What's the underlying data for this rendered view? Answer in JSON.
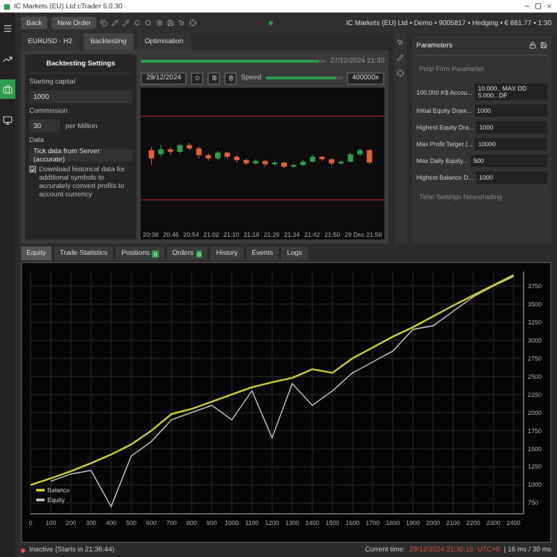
{
  "window": {
    "title": "IC Markets (EU) Ltd cTrader 5.0.30"
  },
  "rail": [
    {
      "selected": false
    },
    {
      "selected": false
    },
    {
      "selected": true
    },
    {
      "selected": false
    }
  ],
  "toolbar": {
    "buttons": [
      "Back",
      "New Order"
    ],
    "account": "IC Markets (EU) Ltd • Demo • 9005817 • Hedging • € 861.77 • 1:30"
  },
  "tabs": [
    {
      "label": "EURUSD · H2",
      "selected": false
    },
    {
      "label": "Backtesting",
      "selected": true
    },
    {
      "label": "Optimisation",
      "selected": false
    }
  ],
  "settings": {
    "title": "Backtesting Settings",
    "capital_label": "Starting capital",
    "capital": "1000",
    "commission_label": "Commission",
    "commission": "30",
    "commission_unit": "per Million",
    "data_label": "Data",
    "data": "Tick data from Server (accurate)",
    "download": {
      "checked": true,
      "label": "Download historical data for additional symbols to accurately convert profits to account currency"
    }
  },
  "player": {
    "progress": {
      "level": 0.96,
      "date": "27/12/2024 21:30"
    },
    "end_date": "29/12/2024",
    "speed_label": "Speed",
    "speed": {
      "level": 0.92
    },
    "speed_value": "400000x",
    "times": [
      "20:38",
      "20:46",
      "20:54",
      "21:02",
      "21:10",
      "21:18",
      "21:26",
      "21:34",
      "21:42",
      "21:50",
      "29 Dec 21:58"
    ]
  },
  "parameters": {
    "title": "Parameters",
    "section": "Prop Firm Parameter",
    "rows": [
      {
        "label": "100.000 K$ Accou...",
        "value": "10.000.. MAX DD 5.000.. DF"
      },
      {
        "label": "Initial Equity Draw...",
        "value": "1000"
      },
      {
        "label": "Highest Equity Dra...",
        "value": "1000"
      },
      {
        "label": "Max Profit Target (...",
        "value": "10000"
      },
      {
        "label": "Max Daily Equity...",
        "value": "500"
      },
      {
        "label": "Highest Balance D...",
        "value": "1000"
      }
    ],
    "section2": "Time Settings Newstrading"
  },
  "bottom_tabs": [
    {
      "label": "Equity",
      "selected": true
    },
    {
      "label": "Trade Statistics",
      "selected": false
    },
    {
      "label": "Positions",
      "selected": false,
      "badge": "0"
    },
    {
      "label": "Orders",
      "selected": false,
      "badge": "0"
    },
    {
      "label": "History",
      "selected": false
    },
    {
      "label": "Events",
      "selected": false
    },
    {
      "label": "Logs",
      "selected": false
    }
  ],
  "equity": {
    "chart_data": {
      "type": "line",
      "x": [
        0,
        100,
        200,
        300,
        400,
        500,
        600,
        700,
        800,
        900,
        1000,
        1100,
        1200,
        1300,
        1400,
        1500,
        1600,
        1700,
        1800,
        1900,
        2000,
        2100,
        2200,
        2300,
        2400
      ],
      "series": [
        {
          "name": "Balance",
          "color": "#c8c832",
          "values": [
            1000,
            1090,
            1190,
            1300,
            1420,
            1560,
            1750,
            1980,
            2050,
            2150,
            2250,
            2350,
            2420,
            2480,
            2600,
            2550,
            2750,
            2900,
            3050,
            3180,
            3330,
            3480,
            3620,
            3760,
            3900
          ]
        },
        {
          "name": "Equity",
          "color": "#bbbbbb",
          "values": [
            null,
            1050,
            1150,
            1200,
            700,
            1400,
            1600,
            1900,
            2000,
            2100,
            1900,
            2300,
            1650,
            2400,
            2100,
            2300,
            2550,
            2700,
            2850,
            3150,
            3200,
            3400,
            3600,
            3750,
            3880
          ]
        }
      ],
      "xlim": [
        0,
        2450
      ],
      "ylim": [
        600,
        3950
      ],
      "xticks": [
        0,
        100,
        200,
        300,
        400,
        500,
        600,
        700,
        800,
        900,
        1000,
        1100,
        1200,
        1300,
        1400,
        1500,
        1600,
        1700,
        1800,
        1900,
        2000,
        2100,
        2200,
        2300,
        2400
      ],
      "yticks": [
        750,
        1000,
        1250,
        1500,
        1750,
        2000,
        2250,
        2500,
        2750,
        3000,
        3250,
        3500,
        3750
      ],
      "grid": true,
      "legend": "lower left"
    }
  },
  "status": {
    "state": "Inactive (Starts in 21:36:44)",
    "time_label": "Current time:",
    "time": "29/12/2024 21:30:15",
    "zone": "UTC+0",
    "latency": "| 16 ms / 30 ms"
  }
}
